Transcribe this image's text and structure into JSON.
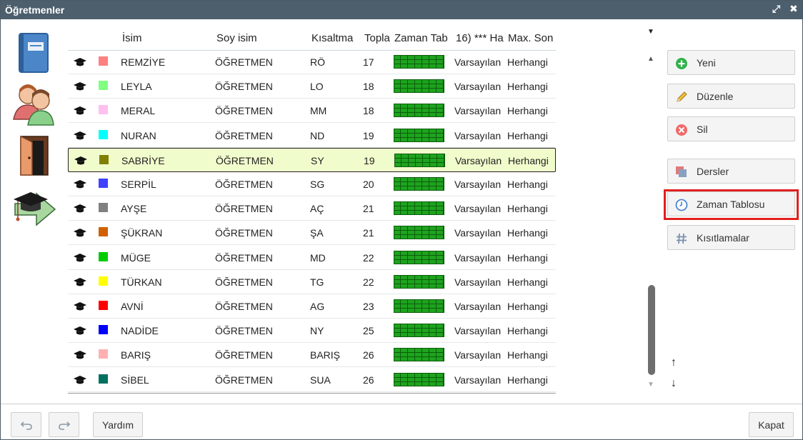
{
  "window": {
    "title": "Öğretmenler"
  },
  "columns": {
    "name": "İsim",
    "surname": "Soy isim",
    "short": "Kısaltma",
    "total": "Topla",
    "timetable": "Zaman Tab",
    "hours": "16) *** Ha",
    "max": "Max. Son"
  },
  "rows": [
    {
      "name": "REMZİYE",
      "surname": "ÖĞRETMEN",
      "short": "RÖ",
      "total": "17",
      "hours": "Varsayılan",
      "max": "Herhangi",
      "color": "#ff8080"
    },
    {
      "name": "LEYLA",
      "surname": "ÖĞRETMEN",
      "short": "LO",
      "total": "18",
      "hours": "Varsayılan",
      "max": "Herhangi",
      "color": "#80ff80"
    },
    {
      "name": "MERAL",
      "surname": "ÖĞRETMEN",
      "short": "MM",
      "total": "18",
      "hours": "Varsayılan",
      "max": "Herhangi",
      "color": "#ffc0f0"
    },
    {
      "name": "NURAN",
      "surname": "ÖĞRETMEN",
      "short": "ND",
      "total": "19",
      "hours": "Varsayılan",
      "max": "Herhangi",
      "color": "#00ffff"
    },
    {
      "name": "SABRİYE",
      "surname": "ÖĞRETMEN",
      "short": "SY",
      "total": "19",
      "hours": "Varsayılan",
      "max": "Herhangi",
      "color": "#808000"
    },
    {
      "name": "SERPİL",
      "surname": "ÖĞRETMEN",
      "short": "SG",
      "total": "20",
      "hours": "Varsayılan",
      "max": "Herhangi",
      "color": "#4040ff"
    },
    {
      "name": "AYŞE",
      "surname": "ÖĞRETMEN",
      "short": "AÇ",
      "total": "21",
      "hours": "Varsayılan",
      "max": "Herhangi",
      "color": "#808080"
    },
    {
      "name": "ŞÜKRAN",
      "surname": "ÖĞRETMEN",
      "short": "ŞA",
      "total": "21",
      "hours": "Varsayılan",
      "max": "Herhangi",
      "color": "#d06000"
    },
    {
      "name": "MÜGE",
      "surname": "ÖĞRETMEN",
      "short": "MD",
      "total": "22",
      "hours": "Varsayılan",
      "max": "Herhangi",
      "color": "#00cc00"
    },
    {
      "name": "TÜRKAN",
      "surname": "ÖĞRETMEN",
      "short": "TG",
      "total": "22",
      "hours": "Varsayılan",
      "max": "Herhangi",
      "color": "#ffff00"
    },
    {
      "name": "AVNİ",
      "surname": "ÖĞRETMEN",
      "short": "AG",
      "total": "23",
      "hours": "Varsayılan",
      "max": "Herhangi",
      "color": "#ff0000"
    },
    {
      "name": "NADİDE",
      "surname": "ÖĞRETMEN",
      "short": "NY",
      "total": "25",
      "hours": "Varsayılan",
      "max": "Herhangi",
      "color": "#0000ff"
    },
    {
      "name": "BARIŞ",
      "surname": "ÖĞRETMEN",
      "short": "BARIŞ",
      "total": "26",
      "hours": "Varsayılan",
      "max": "Herhangi",
      "color": "#ffb0b0"
    },
    {
      "name": "SİBEL",
      "surname": "ÖĞRETMEN",
      "short": "SUA",
      "total": "26",
      "hours": "Varsayılan",
      "max": "Herhangi",
      "color": "#007060"
    }
  ],
  "selected_row": "SABRİYE",
  "actions": {
    "new": "Yeni",
    "edit": "Düzenle",
    "delete": "Sil",
    "lessons": "Dersler",
    "timetable": "Zaman Tablosu",
    "constraints": "Kısıtlamalar"
  },
  "footer": {
    "undo_icon": "undo-icon",
    "redo_icon": "redo-icon",
    "help": "Yardım",
    "close": "Kapat"
  },
  "icons": {
    "left": [
      "subjects-book-icon",
      "teachers-icon",
      "classroom-door-icon",
      "graduation-arrow-icon"
    ],
    "row": "graduation-cap-icon"
  },
  "colors": {
    "titlebar": "#4d5f6d",
    "selected_row": "#f1fccc",
    "highlight_border": "#e0201f",
    "timetable_green": "#1ea31e"
  }
}
